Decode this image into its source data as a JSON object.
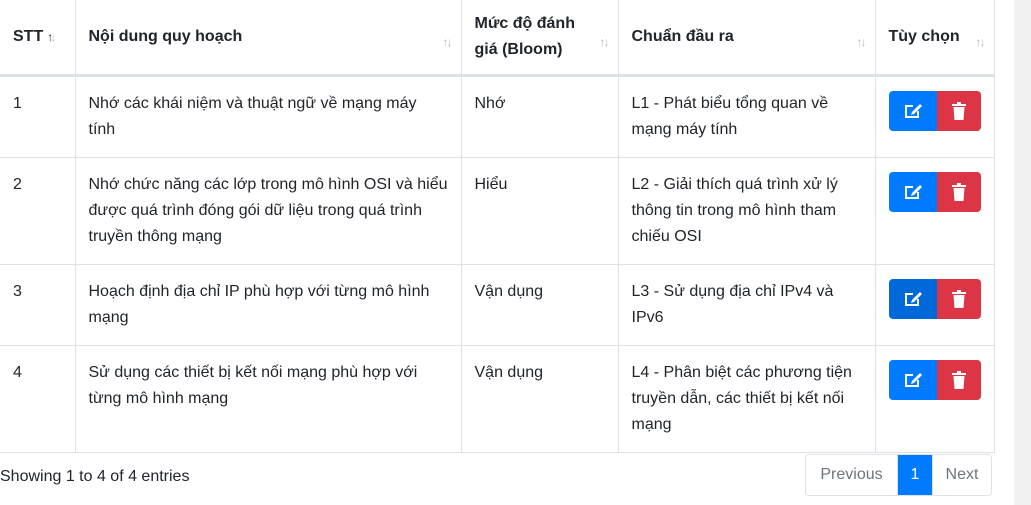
{
  "table": {
    "headers": [
      "STT",
      "Nội dung quy hoạch",
      "Mức độ đánh giá (Bloom)",
      "Chuẩn đầu ra",
      "Tùy chọn"
    ],
    "sort_icon_active": "↑↓",
    "sort_icon": "↑↓",
    "rows": [
      {
        "stt": "1",
        "content": "Nhớ các khái niệm và thuật ngữ về mạng máy tính",
        "level": "Nhớ",
        "outcome": "L1 - Phát biểu tổng quan về mạng máy tính"
      },
      {
        "stt": "2",
        "content": "Nhớ chức năng các lớp trong mô hình OSI và hiểu được quá trình đóng gói dữ liệu trong quá trình truyền thông mạng",
        "level": "Hiểu",
        "outcome": "L2 - Giải thích quá trình xử lý thông tin trong mô hình tham chiếu OSI"
      },
      {
        "stt": "3",
        "content": "Hoạch định địa chỉ IP phù hợp với từng mô hình mạng",
        "level": "Vận dụng",
        "outcome": "L3 - Sử dụng địa chỉ IPv4 và IPv6"
      },
      {
        "stt": "4",
        "content": "Sử dụng các thiết bị kết nối mạng phù hợp với từng mô hình mạng",
        "level": "Vận dụng",
        "outcome": "L4 - Phân biệt các phương tiện truyền dẫn, các thiết bị kết nối mạng"
      }
    ]
  },
  "footer": {
    "info": "Showing 1 to 4 of 4 entries",
    "prev_label": "Previous",
    "current_page": "1",
    "next_label": "Next"
  },
  "icons": {
    "edit": "edit-icon",
    "delete": "trash-icon",
    "sort": "sort-icon"
  },
  "colors": {
    "primary": "#007bff",
    "danger": "#dc3545",
    "border": "#dee2e6"
  }
}
